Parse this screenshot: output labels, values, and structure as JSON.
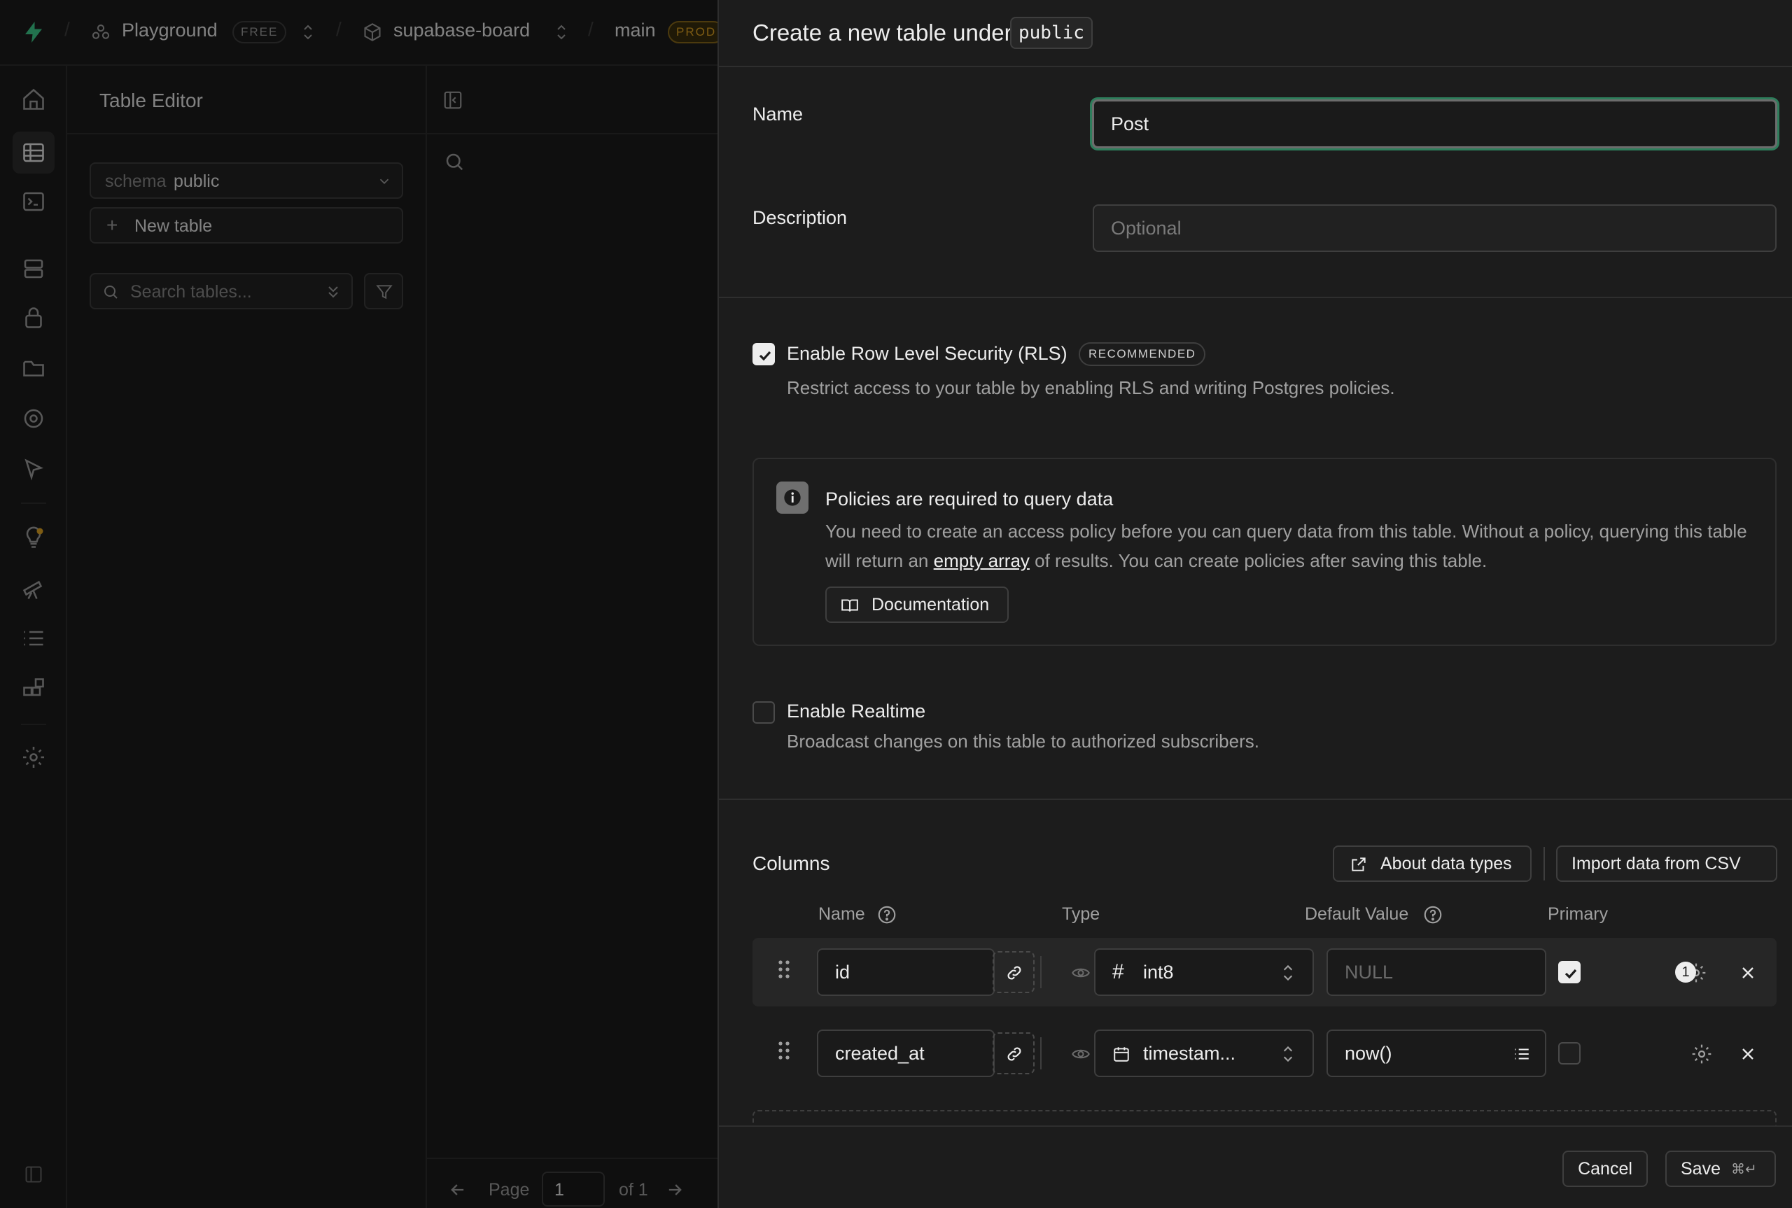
{
  "topbar": {
    "org": "Playground",
    "org_plan": "FREE",
    "project": "supabase-board",
    "branch": "main",
    "branch_badge": "PROD"
  },
  "sidebar": {
    "title": "Table Editor",
    "schema_label": "schema",
    "schema_value": "public",
    "new_table": "New table",
    "search_placeholder": "Search tables..."
  },
  "pagination": {
    "page_label": "Page",
    "page_value": "1",
    "of_label": "of 1"
  },
  "dialog": {
    "title": "Create a new table under",
    "schema_chip": "public",
    "name_label": "Name",
    "name_value": "Post",
    "description_label": "Description",
    "description_placeholder": "Optional",
    "rls": {
      "checked": true,
      "label": "Enable Row Level Security (RLS)",
      "badge": "RECOMMENDED",
      "help": "Restrict access to your table by enabling RLS and writing Postgres policies."
    },
    "callout": {
      "title": "Policies are required to query data",
      "text_before": "You need to create an access policy before you can query data from this table. Without a policy, querying this table will return an",
      "link": "empty array",
      "text_after": "of results. You can create policies after saving this table.",
      "button": "Documentation"
    },
    "realtime": {
      "checked": false,
      "label": "Enable Realtime",
      "help": "Broadcast changes on this table to authorized subscribers."
    },
    "columns": {
      "title": "Columns",
      "about_button": "About data types",
      "import_button": "Import data from CSV",
      "headers": {
        "name": "Name",
        "type": "Type",
        "default": "Default Value",
        "primary": "Primary"
      },
      "rows": [
        {
          "name": "id",
          "type": "int8",
          "type_icon": "hash-icon",
          "default": "",
          "default_placeholder": "NULL",
          "primary": true,
          "settings_count": "1"
        },
        {
          "name": "created_at",
          "type": "timestam...",
          "type_icon": "calendar-icon",
          "default": "now()",
          "default_placeholder": "",
          "primary": false,
          "settings_count": ""
        }
      ]
    },
    "footer": {
      "cancel": "Cancel",
      "save": "Save",
      "save_shortcut": "⌘↵"
    }
  },
  "colors": {
    "accent_green": "#3ecf8e",
    "focus_ring": "#2e7d5b",
    "prod_badge": "#e5a823"
  }
}
